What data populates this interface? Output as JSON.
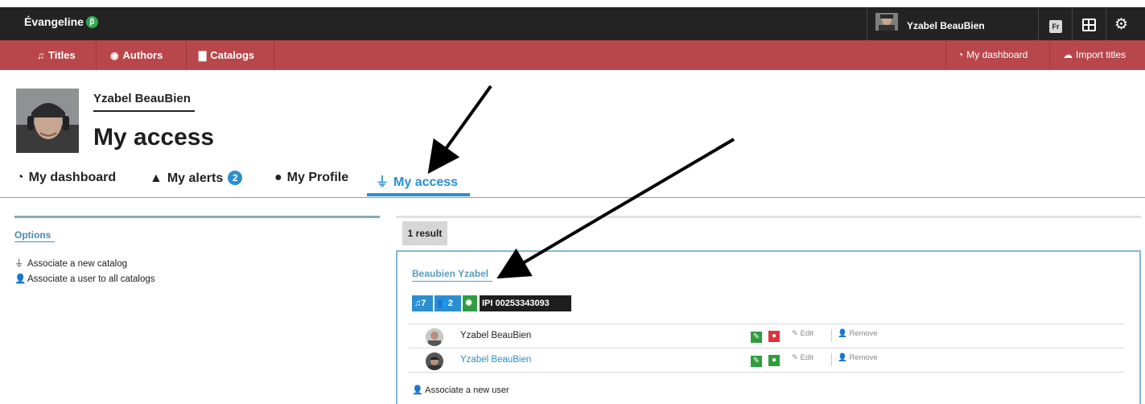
{
  "app": {
    "name": "Évangeline",
    "beta_label": "β"
  },
  "topbar": {
    "user_name": "Yzabel BeauBien",
    "lang_button": "Fr",
    "icons": [
      "grid-icon",
      "gear-icon"
    ]
  },
  "nav": {
    "items": [
      {
        "label": "Titles",
        "icon": "music-note-icon"
      },
      {
        "label": "Authors",
        "icon": "user-circle-icon"
      },
      {
        "label": "Catalogs",
        "icon": "book-icon"
      }
    ],
    "right": [
      {
        "label": "My dashboard",
        "icon": "dashboard-icon"
      },
      {
        "label": "Import titles",
        "icon": "cloud-upload-icon"
      }
    ]
  },
  "profile": {
    "name": "Yzabel BeauBien",
    "page_title": "My access"
  },
  "tabs": [
    {
      "label": "My dashboard",
      "icon": "dashboard-icon"
    },
    {
      "label": "My alerts",
      "icon": "warning-icon",
      "badge": "2"
    },
    {
      "label": "My Profile",
      "icon": "user-icon"
    },
    {
      "label": "My access",
      "icon": "plug-icon",
      "active": true
    }
  ],
  "options": {
    "title": "Options",
    "items": [
      {
        "label": "Associate a new catalog",
        "icon": "plug-icon"
      },
      {
        "label": "Associate a user to all catalogs",
        "icon": "add-user-icon"
      }
    ]
  },
  "results": {
    "count_label": "1 result",
    "card": {
      "title": "Beaubien Yzabel",
      "badges": {
        "titles": "7",
        "users": "2",
        "ipi": "IPI 00253343093"
      },
      "users": [
        {
          "name": "Yzabel BeauBien",
          "link": false,
          "edit": "Edit",
          "remove": "Remove"
        },
        {
          "name": "Yzabel BeauBien",
          "link": true,
          "edit": "Edit",
          "remove": "Remove"
        }
      ],
      "associate_label": "Associate a new user"
    }
  },
  "colors": {
    "topbar": "#232323",
    "navbar": "#b7474a",
    "accent": "#2a8fd0",
    "green": "#2e9d3f",
    "red": "#e0323c"
  }
}
